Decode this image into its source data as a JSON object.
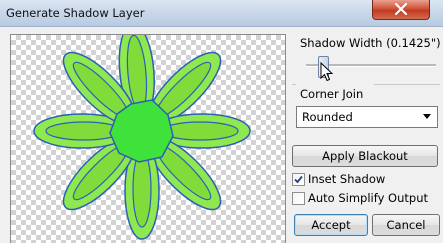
{
  "window": {
    "title": "Generate Shadow Layer"
  },
  "icons": {
    "close": "close-icon",
    "cursor": "pointer-cursor-icon",
    "check": "check-icon"
  },
  "colors": {
    "petal_fill": "#8fe84f",
    "petal_inner": "#7fdc3a",
    "outline": "#2b5fb8",
    "center": "#39e33a"
  },
  "controls": {
    "shadow_width_label": "Shadow Width (0.1425\")",
    "shadow_width_value": 0.1425,
    "corner_join_label": "Corner Join",
    "corner_join_value": "Rounded",
    "apply_blackout_label": "Apply Blackout",
    "inset_shadow_label": "Inset Shadow",
    "inset_shadow_checked": true,
    "auto_simplify_label": "Auto Simplify Output",
    "auto_simplify_checked": false,
    "accept_label": "Accept",
    "cancel_label": "Cancel"
  }
}
